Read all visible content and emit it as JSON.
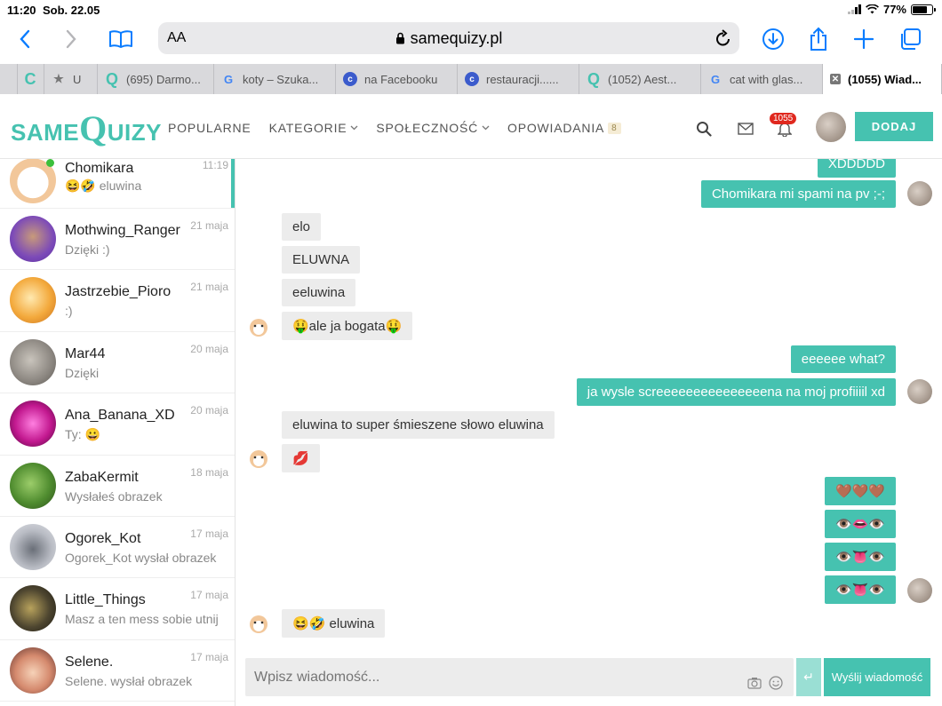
{
  "status": {
    "time": "11:20",
    "date": "Sob. 22.05",
    "battery": "77%",
    "battery_level": 0.77
  },
  "browser": {
    "text_size": "AA",
    "url": "samequizy.pl",
    "tabs": [
      {
        "label": "U",
        "icon": "star-icon"
      },
      {
        "label": "(695) Darmo...",
        "icon": "samequizy-favicon"
      },
      {
        "label": "koty – Szuka...",
        "icon": "google-favicon"
      },
      {
        "label": "na Facebooku",
        "icon": "c-favicon"
      },
      {
        "label": "restauracji......",
        "icon": "c-favicon"
      },
      {
        "label": "(1052) Aest...",
        "icon": "samequizy-favicon"
      },
      {
        "label": "cat with glas...",
        "icon": "google-favicon"
      },
      {
        "label": "(1055) Wiad...",
        "icon": "close-tab-icon",
        "active": true
      }
    ]
  },
  "site": {
    "logo_same": "same",
    "logo_q": "Q",
    "logo_uizy": "UIZY",
    "nav": {
      "popularne": "POPULARNE",
      "kategorie": "KATEGORIE",
      "spolecznosc": "SPOŁECZNOŚĆ",
      "opowiadania": "OPOWIADANIA",
      "opowiadania_badge": "8"
    },
    "notifications": "1055",
    "add_button": "DODAJ"
  },
  "conversations": [
    {
      "name": "Chomikara",
      "preview": "😆🤣 eluwina",
      "date": "11:19",
      "active": true,
      "online": true
    },
    {
      "name": "Mothwing_Ranger",
      "preview": "Dzięki :)",
      "date": "21 maja"
    },
    {
      "name": "Jastrzebie_Pioro",
      "preview": ":)",
      "date": "21 maja"
    },
    {
      "name": "Mar44",
      "preview": "Dzięki",
      "date": "20 maja"
    },
    {
      "name": "Ana_Banana_XD",
      "preview": "Ty: 😀",
      "date": "20 maja"
    },
    {
      "name": "ZabaKermit",
      "preview": "Wysłałeś obrazek",
      "date": "18 maja"
    },
    {
      "name": "Ogorek_Kot",
      "preview": "Ogorek_Kot wysłał obrazek",
      "date": "17 maja"
    },
    {
      "name": "Little_Things",
      "preview": "Masz a ten mess sobie utnij",
      "date": "17 maja"
    },
    {
      "name": "Selene.",
      "preview": "Selene. wysłał obrazek",
      "date": "17 maja"
    }
  ],
  "messages": [
    {
      "dir": "out",
      "text": "XDDDDD"
    },
    {
      "dir": "out",
      "text": "Chomikara mi spami na pv ;-;"
    },
    {
      "dir": "in",
      "text": "elo"
    },
    {
      "dir": "in",
      "text": "ELUWNA"
    },
    {
      "dir": "in",
      "text": "eeluwina"
    },
    {
      "dir": "in",
      "text": "🤑ale ja bogata🤑"
    },
    {
      "dir": "out",
      "text": "eeeeee what?"
    },
    {
      "dir": "out",
      "text": "ja wysle screeeeeeeeeeeeeeena na moj profiiiil xd"
    },
    {
      "dir": "in",
      "text": "eluwina to super śmieszene słowo eluwina"
    },
    {
      "dir": "in",
      "text": "💋"
    },
    {
      "dir": "out",
      "text": "🤎🤎🤎"
    },
    {
      "dir": "out",
      "text": "👁️👄👁️"
    },
    {
      "dir": "out",
      "text": "👁️👅👁️"
    },
    {
      "dir": "out",
      "text": "👁️👅👁️"
    },
    {
      "dir": "in",
      "text": "😆🤣 eluwina"
    }
  ],
  "composer": {
    "placeholder": "Wpisz wiadomość...",
    "send_label": "Wyślij wiadomość",
    "enter_symbol": "↵"
  }
}
